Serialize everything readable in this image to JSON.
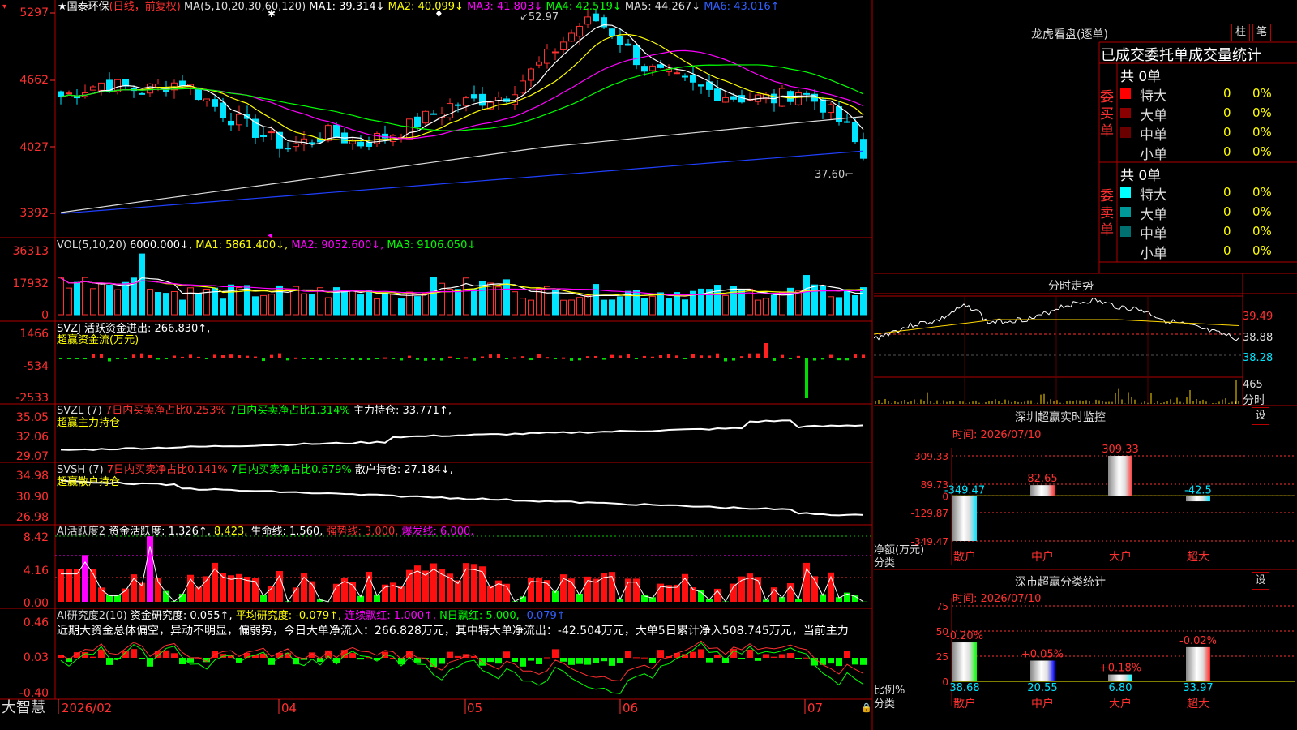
{
  "stock": {
    "star": "★",
    "name": "国泰环保",
    "mode": "(日线，前复权)",
    "high_label": "52.97",
    "low_label": "37.60"
  },
  "price_axis": [
    "5297",
    "4662",
    "4027",
    "3392"
  ],
  "ma_header": [
    {
      "t": "MA(5,10,20,30,60,120)",
      "c": "#dddddd"
    },
    {
      "t": "MA1: 39.314↓",
      "c": "#ffffff"
    },
    {
      "t": "MA2: 40.099↓",
      "c": "#ffff00"
    },
    {
      "t": "MA3: 41.803↓",
      "c": "#ff00ff"
    },
    {
      "t": "MA4: 42.519↓",
      "c": "#00ff00"
    },
    {
      "t": "MA5: 44.267↓",
      "c": "#dddddd"
    },
    {
      "t": "MA6: 43.016↑",
      "c": "#3060ff"
    }
  ],
  "vol": {
    "axis": [
      "36313",
      "17932",
      "0"
    ],
    "header": [
      {
        "t": "VOL(5,10,20)",
        "c": "#dddddd"
      },
      {
        "t": "6000.000↓,",
        "c": "#ffffff"
      },
      {
        "t": "MA1: 5861.400↓,",
        "c": "#ffff00"
      },
      {
        "t": "MA2: 9052.600↓,",
        "c": "#ff00ff"
      },
      {
        "t": "MA3: 9106.050↓",
        "c": "#00ff00"
      }
    ]
  },
  "svzj": {
    "axis": [
      "1466",
      "-534",
      "-2533"
    ],
    "line1": "SVZJ  活跃资金进出: 266.830↑,",
    "line2": "超赢资金流(万元)"
  },
  "svzl": {
    "axis": [
      "35.05",
      "32.06",
      "29.07"
    ],
    "line1": [
      {
        "t": "SVZL (7)",
        "c": "#dddddd"
      },
      {
        "t": "7日内买卖净占比0.253%",
        "c": "#ff3030"
      },
      {
        "t": "7日内买卖净占比1.314%",
        "c": "#00ff00"
      },
      {
        "t": "主力持仓: 33.771↑,",
        "c": "#ffffff"
      }
    ],
    "line2": "超赢主力持仓"
  },
  "svsh": {
    "axis": [
      "34.98",
      "30.90",
      "26.98"
    ],
    "line1": [
      {
        "t": "SVSH (7)",
        "c": "#dddddd"
      },
      {
        "t": "7日内买卖净占比0.141%",
        "c": "#ff3030"
      },
      {
        "t": "7日内买卖净占比0.679%",
        "c": "#00ff00"
      },
      {
        "t": "散户持仓: 27.184↓,",
        "c": "#ffffff"
      }
    ],
    "line2": "超赢散户持仓"
  },
  "ai1": {
    "axis": [
      "8.42",
      "4.16",
      "0.00"
    ],
    "line1": [
      {
        "t": "AI活跃度2",
        "c": "#dddddd"
      },
      {
        "t": "资金活跃度: 1.326↑,",
        "c": "#ffffff"
      },
      {
        "t": "8.423,",
        "c": "#ffff00"
      },
      {
        "t": "生命线: 1.560,",
        "c": "#ffffff"
      },
      {
        "t": "强势线: 3.000,",
        "c": "#ff3030"
      },
      {
        "t": "爆发线: 6.000,",
        "c": "#ff00ff"
      }
    ]
  },
  "ai2": {
    "axis": [
      "0.46",
      "0.03",
      "-0.40"
    ],
    "line1": [
      {
        "t": "AI研究度2(10)",
        "c": "#dddddd"
      },
      {
        "t": "资金研究度: 0.055↑,",
        "c": "#ffffff"
      },
      {
        "t": "平均研究度: -0.079↑,",
        "c": "#ffff00"
      },
      {
        "t": "连续飘红: 1.000↑,",
        "c": "#ff00ff"
      },
      {
        "t": "N日飘红: 5.000,",
        "c": "#00ff00"
      },
      {
        "t": "-0.079↑",
        "c": "#3060ff"
      }
    ],
    "summary": "近期大资金总体偏空，异动不明显，偏弱势，今日大单净流入：266.828万元，其中特大单净流出：-42.504万元，大单5日累计净入508.745万元，当前主力"
  },
  "date_axis": [
    "2026/02",
    "04",
    "05",
    "06",
    "07"
  ],
  "brand": "大智慧",
  "longhu": {
    "title": "龙虎看盘(逐单)",
    "btn1": "柱",
    "btn2": "笔",
    "subtitle": "已成交委托单成交量统计",
    "buy_label": "委买单",
    "sell_label": "委卖单",
    "buy_total": "共 0单",
    "sell_total": "共 0单",
    "buy_rows": [
      {
        "name": "特大",
        "v": "0",
        "p": "0%"
      },
      {
        "name": "大单",
        "v": "0",
        "p": "0%"
      },
      {
        "name": "中单",
        "v": "0",
        "p": "0%"
      },
      {
        "name": "小单",
        "v": "0",
        "p": "0%"
      }
    ],
    "sell_rows": [
      {
        "name": "特大",
        "v": "0",
        "p": "0%"
      },
      {
        "name": "大单",
        "v": "0",
        "p": "0%"
      },
      {
        "name": "中单",
        "v": "0",
        "p": "0%"
      },
      {
        "name": "小单",
        "v": "0",
        "p": "0%"
      }
    ]
  },
  "intraday": {
    "title": "分时走势",
    "price_labels": [
      "39.49",
      "38.88",
      "38.28"
    ],
    "vol_label": "465",
    "vol_unit": "分时"
  },
  "monitor": {
    "title": "深圳超赢实时监控",
    "set": "设",
    "time": "时间: 2026/07/10",
    "y_labels": [
      "309.33",
      "89.73",
      "0",
      "-129.87",
      "-349.47"
    ],
    "ylabel1": "净额(万元)",
    "ylabel2": "分类",
    "cats": [
      "散户",
      "中户",
      "大户",
      "超大"
    ],
    "values": [
      -349.47,
      82.65,
      309.33,
      -42.5
    ],
    "value_labels": [
      "-349.47",
      "82.65",
      "309.33",
      "-42.5"
    ]
  },
  "classify": {
    "title": "深市超赢分类统计",
    "set": "设",
    "time": "时间: 2026/07/10",
    "y_labels": [
      "75",
      "50",
      "25",
      "0"
    ],
    "ylabel1": "比例%",
    "ylabel2": "分类",
    "cats": [
      "散户",
      "中户",
      "大户",
      "超大"
    ],
    "values": [
      38.68,
      20.55,
      6.8,
      33.97
    ],
    "value_labels": [
      "38.68",
      "20.55",
      "6.80",
      "33.97"
    ],
    "changes": [
      "-0.20%",
      "+0.05%",
      "+0.18%",
      "-0.02%"
    ]
  }
}
